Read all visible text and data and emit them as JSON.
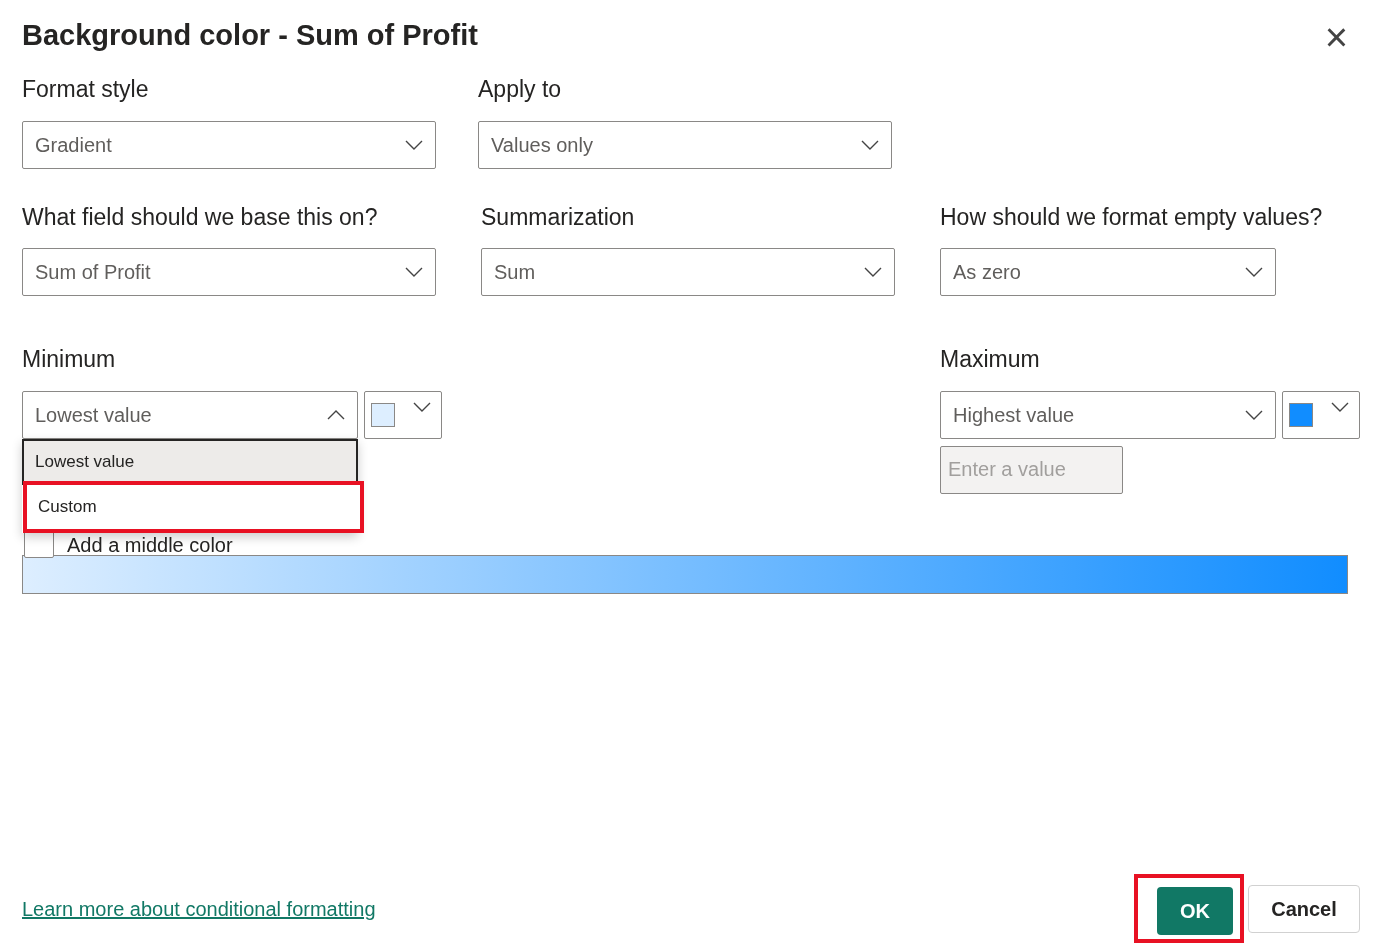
{
  "dialog": {
    "title": "Background color - Sum of Profit",
    "close": "×"
  },
  "row1": [
    {
      "label": "Format style",
      "value": "Gradient"
    },
    {
      "label": "Apply to",
      "value": "Values only"
    }
  ],
  "row2": [
    {
      "label": "What field should we base this on?",
      "value": "Sum of Profit"
    },
    {
      "label": "Summarization",
      "value": "Sum"
    },
    {
      "label": "How should we format empty values?",
      "value": "As zero"
    }
  ],
  "minimum": {
    "label": "Minimum",
    "value": "Lowest value",
    "expanded": true,
    "color": "#ddeeff",
    "options": [
      {
        "label": "Lowest value",
        "selected": true,
        "highlighted": false
      },
      {
        "label": "Custom",
        "selected": false,
        "highlighted": true
      }
    ]
  },
  "maximum": {
    "label": "Maximum",
    "value": "Highest value",
    "expanded": false,
    "color": "#118dff",
    "value_field": {
      "placeholder": "Enter a value",
      "disabled": true
    }
  },
  "middle_color": {
    "label": "Add a middle color",
    "checked": false
  },
  "footer": {
    "link": "Learn more about conditional formatting",
    "buttons": [
      {
        "label": "OK",
        "kind": "primary",
        "highlighted": true
      },
      {
        "label": "Cancel",
        "kind": "secondary",
        "highlighted": false
      }
    ]
  }
}
